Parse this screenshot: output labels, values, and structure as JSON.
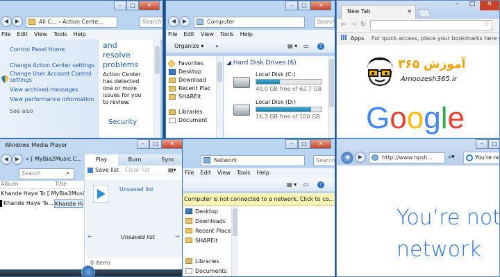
{
  "control_panel": {
    "address": "All C... › Action Cente...",
    "search_placeholder": "Search",
    "menu": [
      "File",
      "Edit",
      "View",
      "Tools",
      "Help"
    ],
    "links": [
      "Control Panel Home",
      "Change Action Center settings",
      "Change User Account Control settings",
      "View archived messages",
      "View performance information"
    ],
    "see_also": "See also",
    "body_text": [
      "and",
      "resolve",
      "problems",
      "Action Center",
      "has detected",
      "one or more",
      "issues for you",
      "to review."
    ],
    "security_heading": "Security"
  },
  "computer": {
    "address": "Computer",
    "search_placeholder": "Search",
    "menu": [
      "File",
      "Edit",
      "View",
      "Tools",
      "Help"
    ],
    "organize": "Organize",
    "nav_items": [
      "Favorites",
      "Desktop",
      "Download",
      "Recent Plac",
      "SHAREit",
      "Libraries",
      "Document"
    ],
    "section_title": "Hard Disk Drives (6)",
    "drives": [
      {
        "name": "Local Disk (C:)",
        "size": "40.0 GB free of 62.7 GB",
        "used_fraction": 0.36
      },
      {
        "name": "Local Disk (D:)",
        "size": "16.3 GB free of 100 GB",
        "used_fraction": 0.84
      }
    ]
  },
  "chrome": {
    "tab_title": "New Tab",
    "apps_label": "Apps",
    "bookmarks_hint": "For quick access, place your bookmarks here on the",
    "logo_persian": "آموزش ۳۶۵",
    "logo_site": "Amoozesh365.ir",
    "google_letters": [
      "G",
      "o",
      "o",
      "g",
      "l",
      "e"
    ],
    "google_colors": [
      "#4285f4",
      "#ea4335",
      "#fbbc05",
      "#4285f4",
      "#34a853",
      "#ea4335"
    ]
  },
  "wmp": {
    "title": "Windows Media Player",
    "breadcrumb": "« [ MyBia2Music.C...",
    "search_placeholder": "Search",
    "tabs": [
      "Play",
      "Burn",
      "Sync"
    ],
    "save_list": "Save list",
    "clear_list": "Clear list",
    "col_album": "Album",
    "col_title": "Title",
    "rows": [
      {
        "album": "Khande Haye To [ MyBia2Music.C",
        "title": ""
      },
      {
        "album": "Khande Haye To...",
        "title": "Khande Haye T"
      }
    ],
    "unsaved_list": "Unsaved list",
    "unsaved_list_bottom": "Unsaved list",
    "items_count": "0 items"
  },
  "network": {
    "address": "Network",
    "search_placeholder": "Search",
    "menu": [
      "File",
      "Edit",
      "View",
      "Tools",
      "Help"
    ],
    "warning": "Computer is not connected to a network. Click to co...",
    "nav_items": [
      "Desktop",
      "Downloads",
      "Recent Places",
      "SHAREit",
      "Libraries",
      "Documents"
    ]
  },
  "ie": {
    "address": "http://www.npsh...",
    "tab_title": "You're no",
    "page_text_1": "You’re not",
    "page_text_2": "network"
  }
}
